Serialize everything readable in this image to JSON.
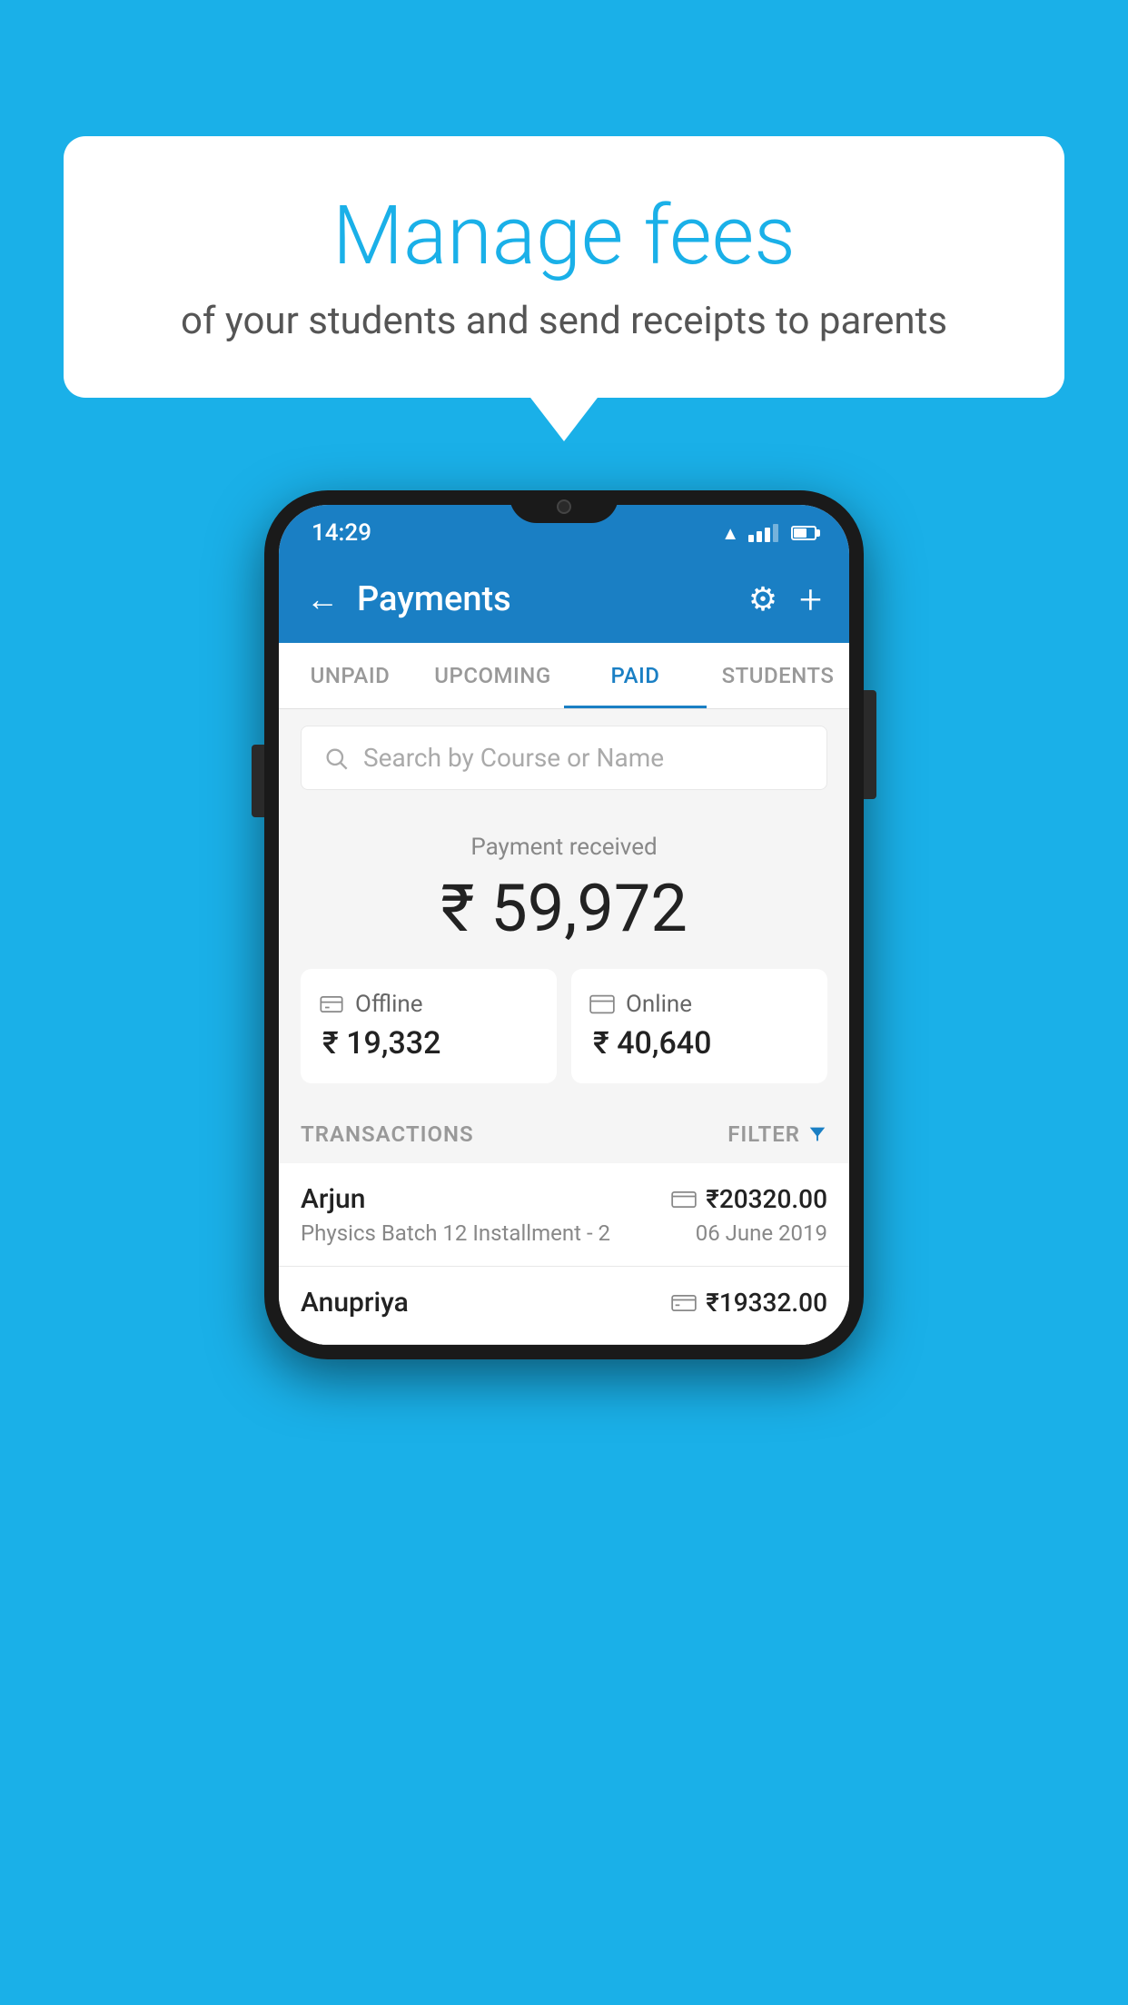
{
  "background_color": "#1ab0e8",
  "speech_bubble": {
    "title": "Manage fees",
    "subtitle": "of your students and send receipts to parents"
  },
  "status_bar": {
    "time": "14:29"
  },
  "header": {
    "title": "Payments",
    "back_label": "←",
    "settings_label": "⚙",
    "add_label": "+"
  },
  "tabs": [
    {
      "id": "unpaid",
      "label": "UNPAID",
      "active": false
    },
    {
      "id": "upcoming",
      "label": "UPCOMING",
      "active": false
    },
    {
      "id": "paid",
      "label": "PAID",
      "active": true
    },
    {
      "id": "students",
      "label": "STUDENTS",
      "active": false
    }
  ],
  "search": {
    "placeholder": "Search by Course or Name"
  },
  "payment_summary": {
    "label": "Payment received",
    "total": "₹ 59,972",
    "offline_label": "Offline",
    "offline_amount": "₹ 19,332",
    "online_label": "Online",
    "online_amount": "₹ 40,640"
  },
  "transactions_section": {
    "label": "TRANSACTIONS",
    "filter_label": "FILTER"
  },
  "transactions": [
    {
      "name": "Arjun",
      "course": "Physics Batch 12 Installment - 2",
      "amount": "₹20320.00",
      "date": "06 June 2019",
      "type": "online"
    },
    {
      "name": "Anupriya",
      "course": "",
      "amount": "₹19332.00",
      "date": "",
      "type": "offline"
    }
  ]
}
